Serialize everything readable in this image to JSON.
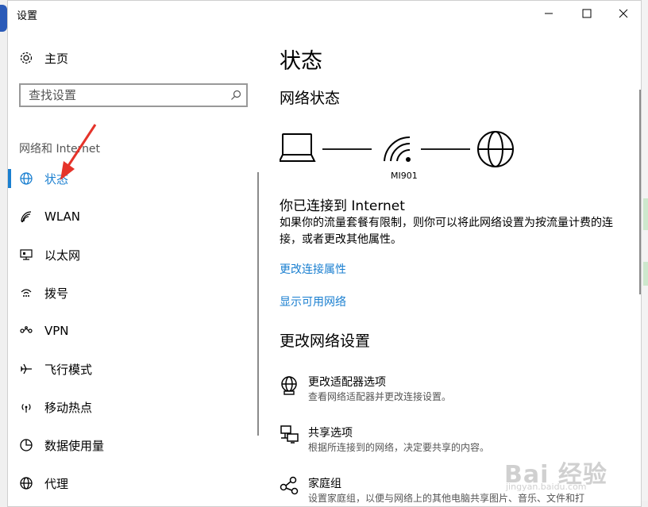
{
  "window": {
    "title": "设置"
  },
  "sidebar": {
    "home_label": "主页",
    "search_placeholder": "查找设置",
    "section_label": "网络和 Internet",
    "items": [
      {
        "label": "状态",
        "icon": "globe-icon",
        "active": true
      },
      {
        "label": "WLAN",
        "icon": "wifi-icon"
      },
      {
        "label": "以太网",
        "icon": "ethernet-icon"
      },
      {
        "label": "拨号",
        "icon": "dialup-icon"
      },
      {
        "label": "VPN",
        "icon": "vpn-icon"
      },
      {
        "label": "飞行模式",
        "icon": "airplane-icon"
      },
      {
        "label": "移动热点",
        "icon": "hotspot-icon"
      },
      {
        "label": "数据使用量",
        "icon": "data-usage-icon"
      },
      {
        "label": "代理",
        "icon": "proxy-globe-icon"
      }
    ]
  },
  "main": {
    "title": "状态",
    "network_status_heading": "网络状态",
    "network_name": "MI901",
    "connected_heading": "你已连接到 Internet",
    "connected_desc": "如果你的流量套餐有限制，则你可以将此网络设置为按流量计费的连接，或者更改其他属性。",
    "link_change_properties": "更改连接属性",
    "link_show_networks": "显示可用网络",
    "change_settings_heading": "更改网络设置",
    "options": [
      {
        "title": "更改适配器选项",
        "desc": "查看网络适配器并更改连接设置。",
        "icon": "adapter-icon"
      },
      {
        "title": "共享选项",
        "desc": "根据所连接到的网络，决定要共享的内容。",
        "icon": "sharing-icon"
      },
      {
        "title": "家庭组",
        "desc": "设置家庭组，以便与网络上的其他电脑共享图片、音乐、文件和打",
        "icon": "homegroup-icon"
      }
    ]
  },
  "colors": {
    "accent": "#1a7fd0",
    "annotation": "#e5332a"
  },
  "watermark": {
    "text": "Bai 经验",
    "sub": "jingyan.baidu.com"
  }
}
